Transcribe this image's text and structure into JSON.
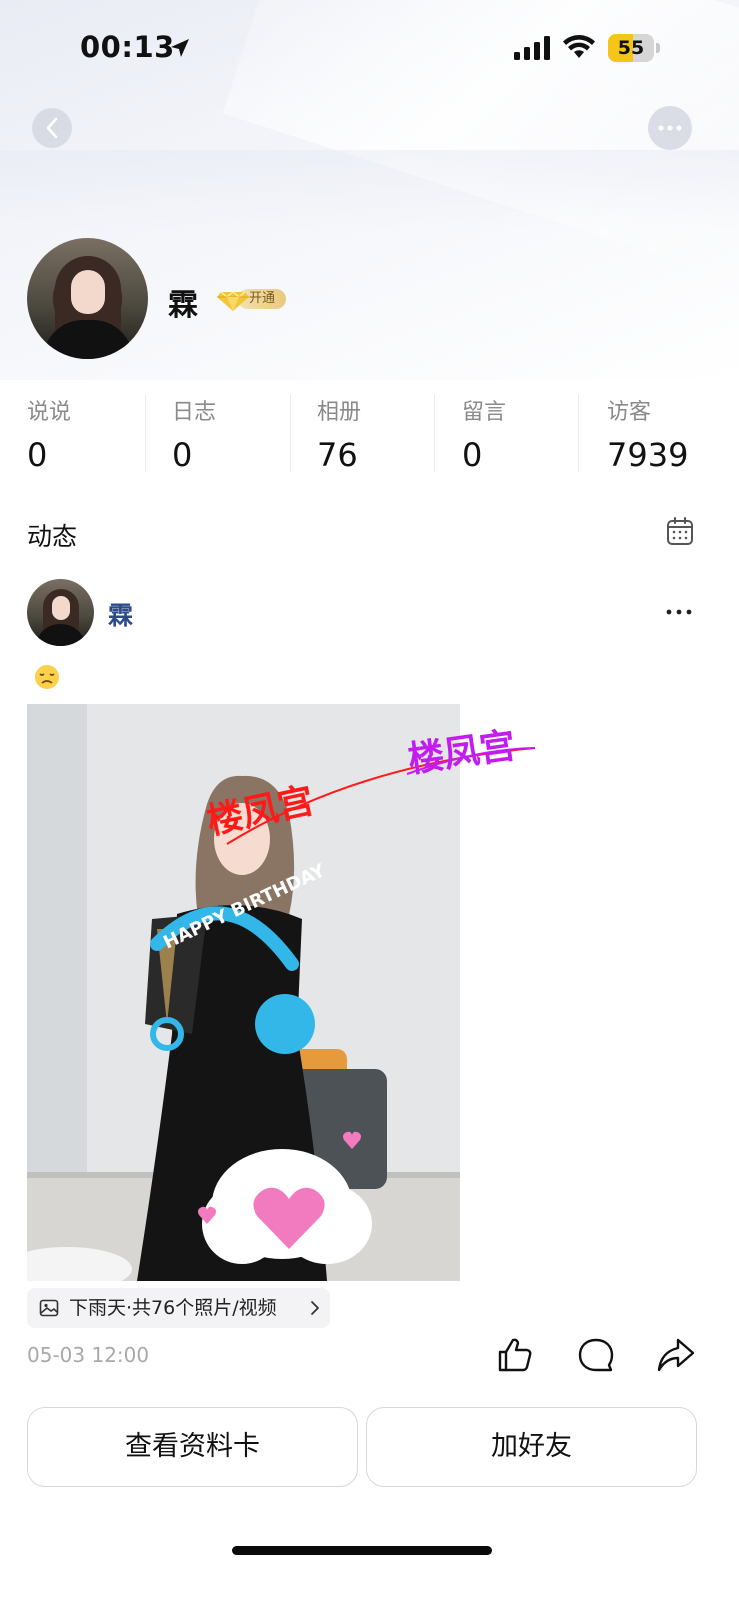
{
  "status_bar": {
    "time": "00:13",
    "battery_level": "55",
    "battery_percent": 55
  },
  "profile": {
    "name": "霖",
    "vip_label": "开通",
    "stats": [
      {
        "label": "说说",
        "value": "0"
      },
      {
        "label": "日志",
        "value": "0"
      },
      {
        "label": "相册",
        "value": "76"
      },
      {
        "label": "留言",
        "value": "0"
      },
      {
        "label": "访客",
        "value": "7939"
      }
    ]
  },
  "feed": {
    "title": "动态",
    "post": {
      "author": "霖",
      "emoji": "😞",
      "photo_texts": {
        "sticker_1": "楼凤宫",
        "sticker_2": "楼凤宫",
        "birthday_text": "HAPPY BIRTHDAY"
      },
      "album_text": "下雨天·共76个照片/视频",
      "timestamp": "05-03 12:00"
    }
  },
  "actions": {
    "view_profile": "查看资料卡",
    "add_friend": "加好友"
  },
  "colors": {
    "author_link": "#2c4a8a",
    "battery": "#f5c518",
    "vip_gold": "#e9c97e",
    "sticker_red": "#ff1a1a",
    "sticker_purple": "#c21cf0",
    "birthday_blue": "#33b7e8"
  }
}
